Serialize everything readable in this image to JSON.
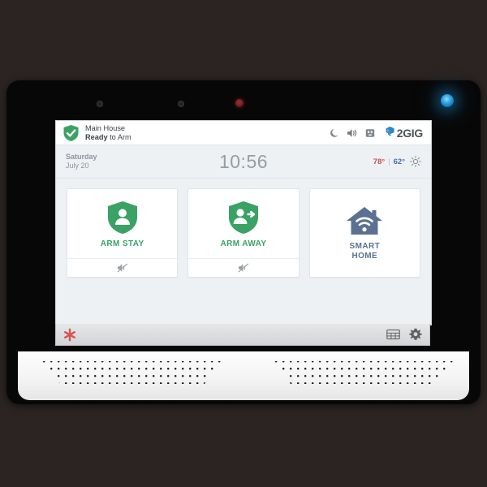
{
  "device": {
    "name": "2gig-security-panel",
    "leds": [
      {
        "name": "sensor-dot-left",
        "color": "#262422"
      },
      {
        "name": "sensor-dot-mid",
        "color": "#262422"
      },
      {
        "name": "camera-led-red",
        "color": "#a33030"
      },
      {
        "name": "status-led-blue",
        "color": "#2ba6e6"
      }
    ]
  },
  "statusbar": {
    "shield_icon": "shield-check-icon",
    "site_name": "Main House",
    "state_bold": "Ready",
    "state_rest": " to Arm",
    "icons": [
      {
        "name": "moon-icon",
        "label": "night-mode"
      },
      {
        "name": "speaker-icon",
        "label": "volume"
      },
      {
        "name": "panel-icon",
        "label": "panel-status"
      }
    ],
    "brand": {
      "mark": "2gig-logo-mark",
      "text": "2GIG",
      "color": "#2f86c5"
    }
  },
  "timerow": {
    "day_of_week": "Saturday",
    "date": "July 20",
    "time": "10:56",
    "weather": {
      "high": "78°",
      "separator": "|",
      "low": "62°",
      "icon": "sun-icon",
      "high_color": "#c0504d",
      "low_color": "#4a6fae"
    }
  },
  "tiles": [
    {
      "id": "arm-stay",
      "label": "ARM STAY",
      "icon": "shield-person-icon",
      "color": "#3aa264",
      "footer_icon": "speaker-mute-icon",
      "has_footer": true
    },
    {
      "id": "arm-away",
      "label": "ARM AWAY",
      "icon": "shield-person-arrow-icon",
      "color": "#3aa264",
      "footer_icon": "speaker-mute-icon",
      "has_footer": true
    },
    {
      "id": "smart-home",
      "label": "SMART\nHOME",
      "label_line1": "SMART",
      "label_line2": "HOME",
      "icon": "house-wifi-icon",
      "color": "#5b7192",
      "footer_icon": "",
      "has_footer": false
    }
  ],
  "toolbar": {
    "panic_icon": "emergency-asterisk-icon",
    "panic_color": "#d9534f",
    "right_icons": [
      {
        "name": "keypad-icon"
      },
      {
        "name": "settings-gear-icon"
      }
    ]
  },
  "colors": {
    "screen_bg": "#eef1f4",
    "accent_green": "#3aa264",
    "accent_slate": "#5b7192",
    "bezel": "#080707",
    "page_bg": "#2b2422"
  }
}
